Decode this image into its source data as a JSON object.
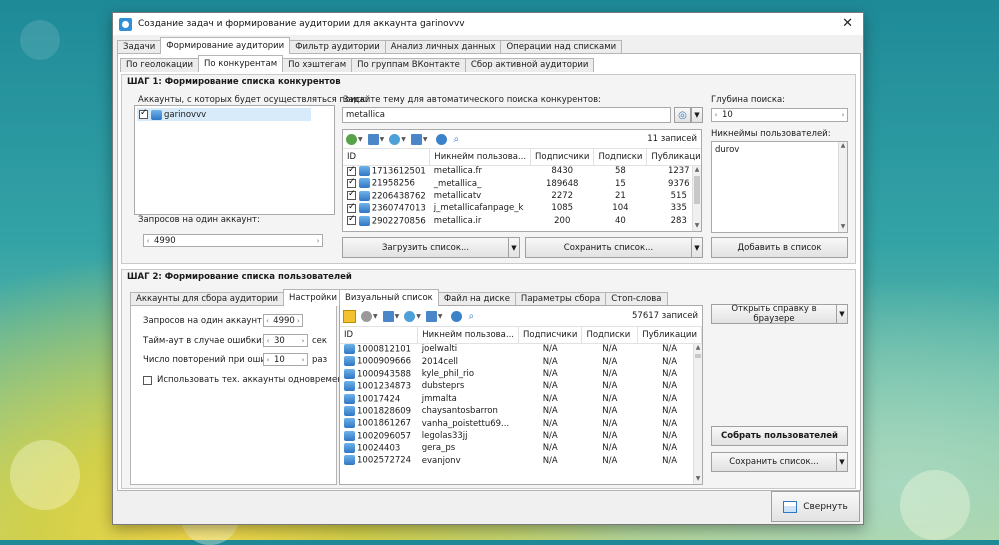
{
  "window": {
    "title": "Создание задач и формирование аудитории для аккаунта garinovvv"
  },
  "main_tabs": [
    "Задачи",
    "Формирование аудитории",
    "Фильтр аудитории",
    "Анализ личных данных",
    "Операции над списками"
  ],
  "sub_tabs": [
    "По геолокации",
    "По конкурентам",
    "По хэштегам",
    "По группам ВКонтакте",
    "Сбор активной аудитории"
  ],
  "step1": {
    "title": "ШАГ 1: Формирование списка конкурентов",
    "accounts_label": "Аккаунты, с которых будет осуществляться поиск:",
    "account_name": "garinovvv",
    "requests_label": "Запросов на один аккаунт:",
    "requests_value": "4990",
    "topic_label": "Задайте тему для автоматического поиска конкурентов:",
    "topic_value": "metallica",
    "records_count": "11 записей",
    "columns": [
      "ID",
      "Никнейм пользова...",
      "Подписчики",
      "Подписки",
      "Публикации"
    ],
    "rows": [
      [
        "1713612501",
        "metallica.fr",
        "8430",
        "58",
        "1237"
      ],
      [
        "21958256",
        "_metallica_",
        "189648",
        "15",
        "9376"
      ],
      [
        "2206438762",
        "metallicatv",
        "2272",
        "21",
        "515"
      ],
      [
        "2360747013",
        "j_metallicafanpage_k",
        "1085",
        "104",
        "335"
      ],
      [
        "2902270856",
        "metallica.ir",
        "200",
        "40",
        "283"
      ]
    ],
    "load_button": "Загрузить список...",
    "save_button": "Сохранить список...",
    "depth_label": "Глубина поиска:",
    "depth_value": "10",
    "nicknames_label": "Никнеймы пользователей:",
    "nickname_value": "durov",
    "add_button": "Добавить в список"
  },
  "step2": {
    "title": "ШАГ 2: Формирование списка пользователей",
    "left_tabs": [
      "Аккаунты для сбора аудитории",
      "Настройки"
    ],
    "requests_label": "Запросов на один аккаунт:",
    "requests_value": "4990",
    "timeout_label": "Тайм-аут в случае ошибки:",
    "timeout_value": "30",
    "timeout_unit": "сек",
    "retries_label": "Число повторений при ошибке:",
    "retries_value": "10",
    "retries_unit": "раз",
    "use_tech_label": "Использовать тех. аккаунты одновременно",
    "right_tabs": [
      "Визуальный список",
      "Файл на диске",
      "Параметры сбора",
      "Стоп-слова"
    ],
    "records_count": "57617 записей",
    "columns": [
      "ID",
      "Никнейм пользова...",
      "Подписчики",
      "Подписки",
      "Публикации"
    ],
    "rows": [
      [
        "1000812101",
        "joelwalti",
        "N/A",
        "N/A",
        "N/A"
      ],
      [
        "1000909666",
        "2014cell",
        "N/A",
        "N/A",
        "N/A"
      ],
      [
        "1000943588",
        "kyle_phil_rio",
        "N/A",
        "N/A",
        "N/A"
      ],
      [
        "1001234873",
        "dubsteprs",
        "N/A",
        "N/A",
        "N/A"
      ],
      [
        "10017424",
        "jmmalta",
        "N/A",
        "N/A",
        "N/A"
      ],
      [
        "1001828609",
        "chaysantosbarron",
        "N/A",
        "N/A",
        "N/A"
      ],
      [
        "1001861267",
        "vanha_poistettu69...",
        "N/A",
        "N/A",
        "N/A"
      ],
      [
        "1002096057",
        "legolas33jj",
        "N/A",
        "N/A",
        "N/A"
      ],
      [
        "10024403",
        "gera_ps",
        "N/A",
        "N/A",
        "N/A"
      ],
      [
        "1002572724",
        "evanjonv",
        "N/A",
        "N/A",
        "N/A"
      ]
    ],
    "open_help_button": "Открыть справку в браузере",
    "collect_button": "Собрать пользователей",
    "save_button": "Сохранить список..."
  },
  "footer": {
    "minimize_button": "Свернуть"
  }
}
